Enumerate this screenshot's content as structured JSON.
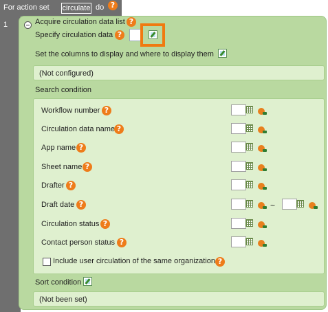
{
  "header": {
    "prefix": "For action set",
    "action_name": "circulate",
    "suffix": "do"
  },
  "row_number": "1",
  "section_title": "Acquire circulation data list",
  "specify_label": "Specify circulation data",
  "columns_label": "Set the columns to display and where to display them",
  "columns_value": "(Not configured)",
  "search_title": "Search condition",
  "conditions": [
    "Workflow number",
    "Circulation data name",
    "App name",
    "Sheet name",
    "Drafter",
    "Draft date",
    "Circulation status",
    "Contact person status"
  ],
  "date_separator": "~",
  "include_label": "Include user circulation of the same organization",
  "sort_label": "Sort condition",
  "sort_value": "(Not been set)",
  "help_glyph": "?",
  "icons": {
    "help": "help-icon",
    "edit": "edit-icon",
    "grid": "grid-select-icon",
    "variable": "variable-icon",
    "collapse": "collapse-icon"
  },
  "colors": {
    "header_bg": "#6f6f6f",
    "panel_green": "#b9d9a0",
    "field_green": "#dff0cf",
    "help_orange": "#ee7c1a",
    "highlight": "#f07a10"
  }
}
